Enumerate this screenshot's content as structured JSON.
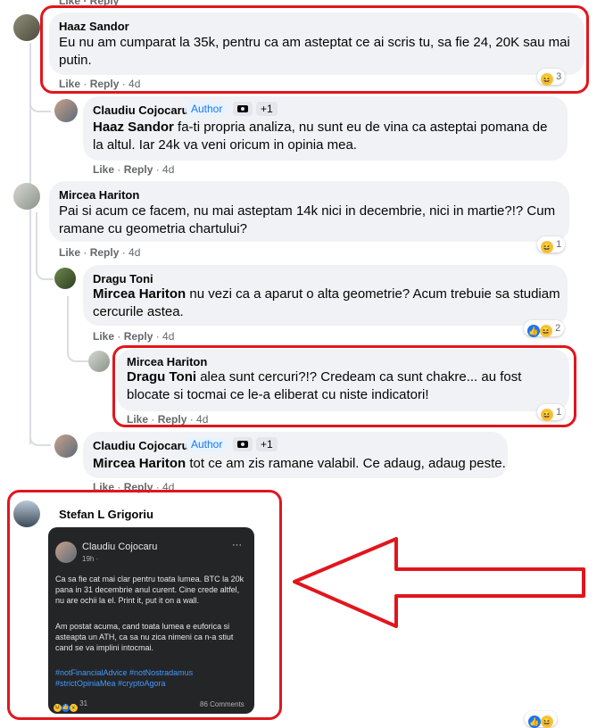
{
  "comments": [
    {
      "name": "Haaz Sandor",
      "text": "Eu nu am cumparat la 35k, pentru ca am asteptat ce ai scris tu, sa fie 24, 20K sau mai putin.",
      "like": "Like",
      "reply": "Reply",
      "time": "4d",
      "reaction_count": "3"
    },
    {
      "name": "Claudiu Cojocaru",
      "author_badge": "Author",
      "extra_badge": "+1",
      "mention": "Haaz Sandor",
      "text": " fa-ti propria analiza, nu sunt eu de vina ca asteptai pomana de la altul. Iar 24k va veni oricum in opinia mea.",
      "like": "Like",
      "reply": "Reply",
      "time": "4d"
    },
    {
      "name": "Mircea Hariton",
      "text": "Pai si acum ce facem, nu mai asteptam 14k nici in decembrie, nici in martie?!? Cum ramane cu geometria chartului?",
      "like": "Like",
      "reply": "Reply",
      "time": "4d",
      "reaction_count": "1"
    },
    {
      "name": "Dragu Toni",
      "mention": "Mircea Hariton",
      "text": " nu vezi ca a aparut o alta geometrie? Acum trebuie sa studiam cercurile astea.",
      "like": "Like",
      "reply": "Reply",
      "time": "4d",
      "reaction_count": "2"
    },
    {
      "name": "Mircea Hariton",
      "mention": "Dragu Toni",
      "text": " alea sunt cercuri?!? Credeam ca sunt chakre... au fost blocate si tocmai ce le-a eliberat cu niste indicatori!",
      "like": "Like",
      "reply": "Reply",
      "time": "4d",
      "reaction_count": "1"
    },
    {
      "name": "Claudiu Cojocaru",
      "author_badge": "Author",
      "extra_badge": "+1",
      "mention": "Mircea Hariton",
      "text": " tot ce am zis ramane valabil. Ce adaug, adaug peste.",
      "like": "Like",
      "reply": "Reply",
      "time": "4d"
    },
    {
      "name": "Stefan L Grigoriu"
    }
  ],
  "embedded_post": {
    "author": "Claudiu Cojocaru",
    "time": "19h ·",
    "menu": "···",
    "body_1": "Ca sa fie cat mai clar pentru toata lumea. BTC la 20k pana in 31 decembrie anul curent. Cine crede altfel, nu are ochii la el. Print it, put it on a wall.",
    "body_2": "Am postat acuma, cand toata lumea e euforica si asteapta un ATH, ca sa nu zica nimeni ca n-a stiut cand se va implini intocmai.",
    "hashtags_1": "#notFinancialAdvice #notNostradamus",
    "hashtags_2": "#strictOpiniaMea #cryptoAgora",
    "reactions": "31",
    "comments": "86 Comments"
  },
  "top_cut_actions": "Like · Reply",
  "colors": {
    "highlight_red": "#e1161d",
    "bubble": "#f0f2f5",
    "author_blue": "#1877f2",
    "meta_gray": "#65676b"
  }
}
